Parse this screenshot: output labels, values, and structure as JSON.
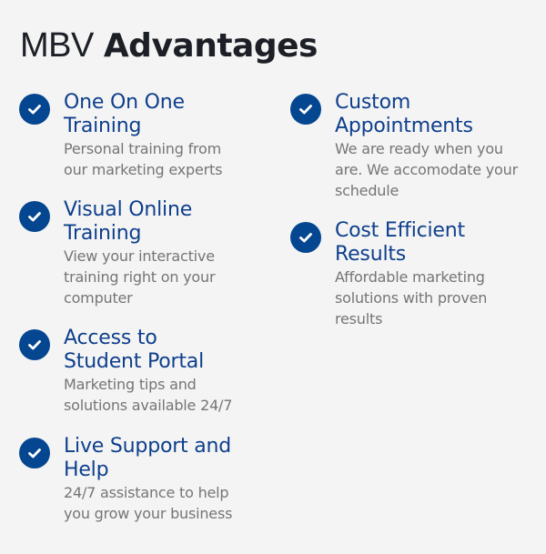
{
  "header": {
    "title_light": "MBV",
    "title_bold": "Advantages"
  },
  "colors": {
    "accent": "#054691",
    "title_blue": "#0e3f8c",
    "desc_gray": "#757575",
    "background": "#f4f4f4"
  },
  "features": [
    {
      "icon": "check-circle-icon",
      "title": "One On One Training",
      "description": "Personal training from our marketing experts"
    },
    {
      "icon": "check-circle-icon",
      "title": "Visual Online Training",
      "description": "View your interactive training right on your computer"
    },
    {
      "icon": "check-circle-icon",
      "title": "Access to Student Portal",
      "description": "Marketing tips and solutions available 24/7"
    },
    {
      "icon": "check-circle-icon",
      "title": "Live Support and Help",
      "description": "24/7 assistance to help you grow your business"
    },
    {
      "icon": "check-circle-icon",
      "title": "Custom Appointments",
      "description": "We are ready when you are. We accomodate your schedule"
    },
    {
      "icon": "check-circle-icon",
      "title": "Cost Efficient Results",
      "description": "Affordable marketing solutions with proven results"
    }
  ]
}
